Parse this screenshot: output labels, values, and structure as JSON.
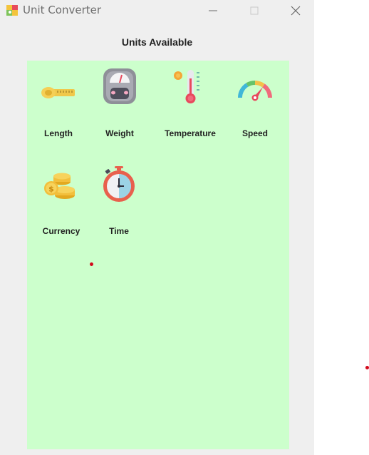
{
  "window": {
    "title": "Unit Converter",
    "icons": {
      "app": "unit-converter-app-icon",
      "minimize": "minimize-icon",
      "maximize": "maximize-icon",
      "close": "close-icon"
    }
  },
  "main": {
    "heading": "Units Available",
    "panel_color": "#ccffcc",
    "units": [
      {
        "label": "Length",
        "icon": "measuring-tape-icon"
      },
      {
        "label": "Weight",
        "icon": "weighing-scale-icon"
      },
      {
        "label": "Temperature",
        "icon": "thermometer-icon"
      },
      {
        "label": "Speed",
        "icon": "speedometer-icon"
      },
      {
        "label": "Currency",
        "icon": "coins-icon"
      },
      {
        "label": "Time",
        "icon": "stopwatch-icon"
      }
    ]
  }
}
